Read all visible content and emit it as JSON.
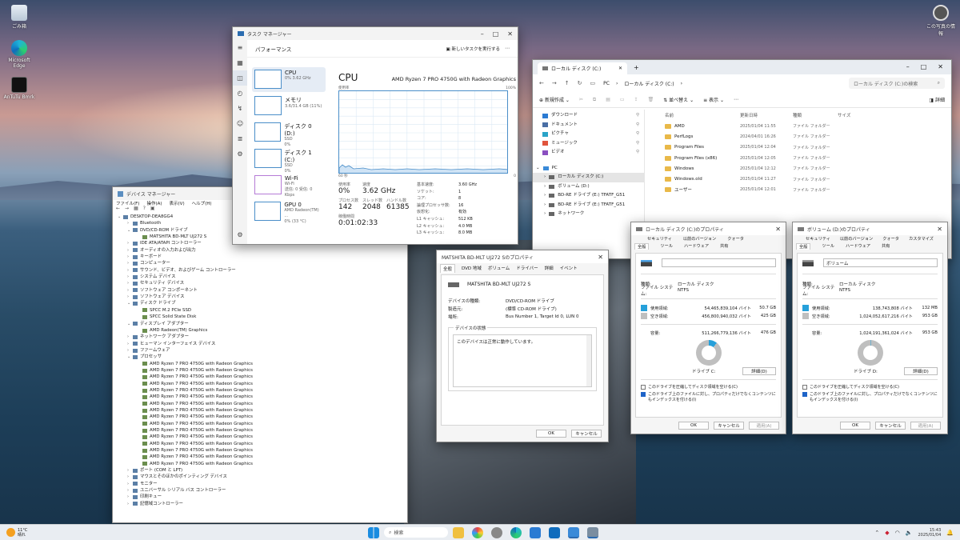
{
  "desktop": {
    "icons": [
      {
        "label": "ごみ箱"
      },
      {
        "label": "Microsoft Edge"
      },
      {
        "label": "AnTuTu Bmrk"
      }
    ],
    "top_right_label": "この写真の情報"
  },
  "task_manager": {
    "title": "タスク マネージャー",
    "section": "パフォーマンス",
    "run_task": "新しいタスクを実行する",
    "items": [
      {
        "name": "CPU",
        "sub": "0%  3.62 GHz"
      },
      {
        "name": "メモリ",
        "sub": "3.6/31.4 GB (11%)"
      },
      {
        "name": "ディスク 0 (D:)",
        "sub": "SSD",
        "sub2": "0%"
      },
      {
        "name": "ディスク 1 (C:)",
        "sub": "SSD",
        "sub2": "0%"
      },
      {
        "name": "Wi-Fi",
        "sub": "Wi-Fi",
        "sub2": "送信: 0 受信: 0 Kbps"
      },
      {
        "name": "GPU 0",
        "sub": "AMD Radeon(TM) ...",
        "sub2": "0% (33 °C)"
      }
    ],
    "header": "CPU",
    "model": "AMD Ryzen 7 PRO 4750G with Radeon Graphics",
    "usage_label": "使用率",
    "usage_max": "100%",
    "graph_left": "60 秒",
    "graph_right": "0",
    "utilization_label": "使用率",
    "utilization": "0%",
    "speed_label": "速度",
    "speed": "3.62 GHz",
    "processes_label": "プロセス数",
    "processes": "142",
    "threads_label": "スレッド数",
    "threads": "2048",
    "handles_label": "ハンドル数",
    "handles": "61385",
    "uptime_label": "稼働時間",
    "uptime": "0:01:02:33",
    "specs": [
      {
        "k": "基本速度:",
        "v": "3.60 GHz"
      },
      {
        "k": "ソケット:",
        "v": "1"
      },
      {
        "k": "コア:",
        "v": "8"
      },
      {
        "k": "論理プロセッサ数:",
        "v": "16"
      },
      {
        "k": "仮想化:",
        "v": "有効"
      },
      {
        "k": "L1 キャッシュ:",
        "v": "512 KB"
      },
      {
        "k": "L2 キャッシュ:",
        "v": "4.0 MB"
      },
      {
        "k": "L3 キャッシュ:",
        "v": "8.0 MB"
      }
    ]
  },
  "device_manager": {
    "title": "デバイス マネージャー",
    "menu": [
      "ファイル(F)",
      "操作(A)",
      "表示(V)",
      "ヘルプ(H)"
    ],
    "tree": [
      {
        "t": "DESKTOP-DEA8GG4",
        "lvl": 0,
        "exp": "v"
      },
      {
        "t": "Bluetooth",
        "lvl": 1,
        "exp": ">"
      },
      {
        "t": "DVD/CD-ROM ドライブ",
        "lvl": 1,
        "exp": "v"
      },
      {
        "t": "MATSHITA BD-MLT UJ272 S",
        "lvl": 2,
        "exp": ""
      },
      {
        "t": "IDE ATA/ATAPI コントローラー",
        "lvl": 1,
        "exp": ">"
      },
      {
        "t": "オーディオの入力および出力",
        "lvl": 1,
        "exp": ">"
      },
      {
        "t": "キーボード",
        "lvl": 1,
        "exp": ">"
      },
      {
        "t": "コンピューター",
        "lvl": 1,
        "exp": ">"
      },
      {
        "t": "サウンド、ビデオ、およびゲーム コントローラー",
        "lvl": 1,
        "exp": ">"
      },
      {
        "t": "システム デバイス",
        "lvl": 1,
        "exp": ">"
      },
      {
        "t": "セキュリティ デバイス",
        "lvl": 1,
        "exp": ">"
      },
      {
        "t": "ソフトウェア コンポーネント",
        "lvl": 1,
        "exp": ">"
      },
      {
        "t": "ソフトウェア デバイス",
        "lvl": 1,
        "exp": ">"
      },
      {
        "t": "ディスク ドライブ",
        "lvl": 1,
        "exp": "v"
      },
      {
        "t": "SPCC M.2 PCIe SSD",
        "lvl": 2,
        "exp": ""
      },
      {
        "t": "SPCC Solid State Disk",
        "lvl": 2,
        "exp": ""
      },
      {
        "t": "ディスプレイ アダプター",
        "lvl": 1,
        "exp": "v"
      },
      {
        "t": "AMD Radeon(TM) Graphics",
        "lvl": 2,
        "exp": ""
      },
      {
        "t": "ネットワーク アダプター",
        "lvl": 1,
        "exp": ">"
      },
      {
        "t": "ヒューマン インターフェイス デバイス",
        "lvl": 1,
        "exp": ">"
      },
      {
        "t": "ファームウェア",
        "lvl": 1,
        "exp": ">"
      },
      {
        "t": "プロセッサ",
        "lvl": 1,
        "exp": "v"
      },
      {
        "t": "AMD Ryzen 7 PRO 4750G with Radeon Graphics",
        "lvl": 2,
        "exp": ""
      },
      {
        "t": "AMD Ryzen 7 PRO 4750G with Radeon Graphics",
        "lvl": 2,
        "exp": ""
      },
      {
        "t": "AMD Ryzen 7 PRO 4750G with Radeon Graphics",
        "lvl": 2,
        "exp": ""
      },
      {
        "t": "AMD Ryzen 7 PRO 4750G with Radeon Graphics",
        "lvl": 2,
        "exp": ""
      },
      {
        "t": "AMD Ryzen 7 PRO 4750G with Radeon Graphics",
        "lvl": 2,
        "exp": ""
      },
      {
        "t": "AMD Ryzen 7 PRO 4750G with Radeon Graphics",
        "lvl": 2,
        "exp": ""
      },
      {
        "t": "AMD Ryzen 7 PRO 4750G with Radeon Graphics",
        "lvl": 2,
        "exp": ""
      },
      {
        "t": "AMD Ryzen 7 PRO 4750G with Radeon Graphics",
        "lvl": 2,
        "exp": ""
      },
      {
        "t": "AMD Ryzen 7 PRO 4750G with Radeon Graphics",
        "lvl": 2,
        "exp": ""
      },
      {
        "t": "AMD Ryzen 7 PRO 4750G with Radeon Graphics",
        "lvl": 2,
        "exp": ""
      },
      {
        "t": "AMD Ryzen 7 PRO 4750G with Radeon Graphics",
        "lvl": 2,
        "exp": ""
      },
      {
        "t": "AMD Ryzen 7 PRO 4750G with Radeon Graphics",
        "lvl": 2,
        "exp": ""
      },
      {
        "t": "AMD Ryzen 7 PRO 4750G with Radeon Graphics",
        "lvl": 2,
        "exp": ""
      },
      {
        "t": "AMD Ryzen 7 PRO 4750G with Radeon Graphics",
        "lvl": 2,
        "exp": ""
      },
      {
        "t": "AMD Ryzen 7 PRO 4750G with Radeon Graphics",
        "lvl": 2,
        "exp": ""
      },
      {
        "t": "AMD Ryzen 7 PRO 4750G with Radeon Graphics",
        "lvl": 2,
        "exp": ""
      },
      {
        "t": "ポート (COM と LPT)",
        "lvl": 1,
        "exp": ">"
      },
      {
        "t": "マウスとそのほかのポインティング デバイス",
        "lvl": 1,
        "exp": ">"
      },
      {
        "t": "モニター",
        "lvl": 1,
        "exp": ">"
      },
      {
        "t": "ユニバーサル シリアル バス コントローラー",
        "lvl": 1,
        "exp": ">"
      },
      {
        "t": "印刷キュー",
        "lvl": 1,
        "exp": ">"
      },
      {
        "t": "記憶域コントローラー",
        "lvl": 1,
        "exp": ">"
      }
    ]
  },
  "explorer": {
    "tab": "ローカル ディスク (C:)",
    "breadcrumb": [
      "PC",
      "ローカル ディスク (C:)"
    ],
    "search_placeholder": "ローカル ディスク (C:)の検索",
    "new_button": "新規作成",
    "sort_button": "並べ替え",
    "view_button": "表示",
    "details_button": "詳細",
    "columns": [
      "名前",
      "更新日時",
      "種類",
      "サイズ"
    ],
    "files": [
      {
        "name": "AMD",
        "date": "2025/01/04 11:55",
        "type": "ファイル フォルダー"
      },
      {
        "name": "PerfLogs",
        "date": "2024/04/01 16:26",
        "type": "ファイル フォルダー"
      },
      {
        "name": "Program Files",
        "date": "2025/01/04 12:04",
        "type": "ファイル フォルダー"
      },
      {
        "name": "Program Files (x86)",
        "date": "2025/01/04 12:05",
        "type": "ファイル フォルダー"
      },
      {
        "name": "Windows",
        "date": "2025/01/04 12:12",
        "type": "ファイル フォルダー"
      },
      {
        "name": "Windows.old",
        "date": "2025/01/04 11:27",
        "type": "ファイル フォルダー"
      },
      {
        "name": "ユーザー",
        "date": "2025/01/04 12:01",
        "type": "ファイル フォルダー"
      }
    ],
    "nav": [
      "ダウンロード",
      "ドキュメント",
      "ピクチャ",
      "ミュージック",
      "ビデオ"
    ],
    "nav_pc": "PC",
    "drives": [
      "ローカル ディスク (C:)",
      "ボリューム (D:)",
      "BD-RE ドライブ (E:) TFATF_G51",
      "BD-RE ドライブ (E:) TFATF_G51",
      "ネットワーク"
    ]
  },
  "dvd_props": {
    "title": "MATSHITA BD-MLT UJ272 Sのプロパティ",
    "tabs": [
      "全般",
      "DVD 地域",
      "ボリューム",
      "ドライバー",
      "詳細",
      "イベント"
    ],
    "device_name": "MATSHITA BD-MLT UJ272 S",
    "rows": [
      {
        "k": "デバイスの種類:",
        "v": "DVD/CD-ROM ドライブ"
      },
      {
        "k": "製造元:",
        "v": "(標準 CD-ROM ドライブ)"
      },
      {
        "k": "場所:",
        "v": "Bus Number 1, Target Id 0, LUN 0"
      }
    ],
    "status_group": "デバイスの状態",
    "status_text": "このデバイスは正常に動作しています。",
    "ok": "OK",
    "cancel": "キャンセル"
  },
  "c_props": {
    "title": "ローカル ディスク (C:)のプロパティ",
    "tabs_top": [
      "セキュリティ",
      "以前のバージョン",
      "クォータ"
    ],
    "tabs_bottom": [
      "全般",
      "ツール",
      "ハードウェア",
      "共有"
    ],
    "type_label": "種類:",
    "type": "ローカル ディスク",
    "fs_label": "ファイル システム:",
    "fs": "NTFS",
    "used_label": "使用領域:",
    "used_bytes": "54,465,839,104 バイト",
    "used_gb": "50.7 GB",
    "free_label": "空き領域:",
    "free_bytes": "456,800,940,032 バイト",
    "free_gb": "425 GB",
    "cap_label": "容量:",
    "cap_bytes": "511,266,779,136 バイト",
    "cap_gb": "476 GB",
    "drive_label": "ドライブ C:",
    "details": "詳細(D)",
    "compress": "このドライブを圧縮してディスク領域を空ける(C)",
    "index": "このドライブ上のファイルに対し、プロパティだけでなくコンテンツにもインデックスを付ける(I)",
    "ok": "OK",
    "cancel": "キャンセル",
    "apply": "適用(A)",
    "used_fraction": 0.107,
    "used_color": "#26a0da",
    "free_color": "#bfbfbf"
  },
  "d_props": {
    "title": "ボリューム (D:)のプロパティ",
    "tabs_top": [
      "セキュリティ",
      "以前のバージョン",
      "クォータ",
      "カスタマイズ"
    ],
    "tabs_bottom": [
      "全般",
      "ツール",
      "ハードウェア",
      "共有"
    ],
    "volume_name": "ボリューム",
    "type_label": "種類:",
    "type": "ローカル ディスク",
    "fs_label": "ファイル システム:",
    "fs": "NTFS",
    "used_label": "使用領域:",
    "used_bytes": "138,743,808 バイト",
    "used_gb": "132 MB",
    "free_label": "空き領域:",
    "free_bytes": "1,024,052,617,216 バイト",
    "free_gb": "953 GB",
    "cap_label": "容量:",
    "cap_bytes": "1,024,191,361,024 バイト",
    "cap_gb": "953 GB",
    "drive_label": "ドライブ D:",
    "details": "詳細(D)",
    "compress": "このドライブを圧縮してディスク領域を空ける(C)",
    "index": "このドライブ上のファイルに対し、プロパティだけでなくコンテンツにもインデックスを付ける(I)",
    "ok": "OK",
    "cancel": "キャンセル",
    "apply": "適用(A)",
    "used_fraction": 0.002
  },
  "taskbar": {
    "weather_temp": "11°C",
    "weather_text": "晴れ",
    "search_placeholder": "検索",
    "time": "15:43",
    "date": "2025/01/04"
  }
}
